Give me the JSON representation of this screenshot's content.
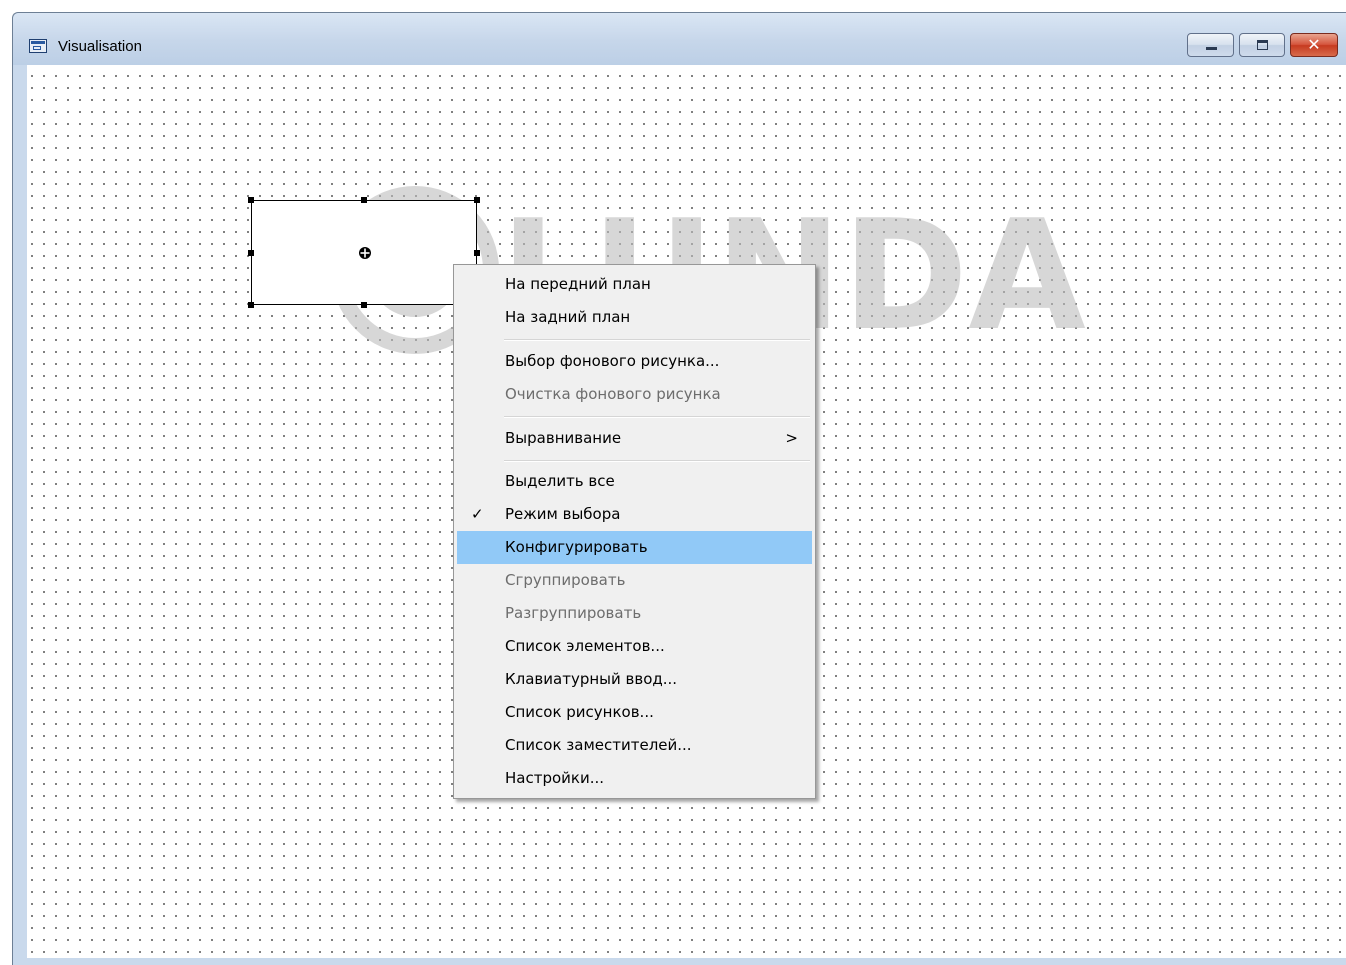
{
  "window": {
    "title": "Visualisation",
    "close_glyph": "✕"
  },
  "watermark": {
    "text": "LUNDA"
  },
  "context_menu": {
    "items": [
      {
        "label": "На передний план"
      },
      {
        "label": "На задний план"
      },
      {
        "label": "Выбор фонового рисунка..."
      },
      {
        "label": "Очистка фонового рисунка",
        "disabled": true
      },
      {
        "label": "Выравнивание",
        "submenu_arrow": ">"
      },
      {
        "label": "Выделить все"
      },
      {
        "label": "Режим выбора",
        "check": "✓"
      },
      {
        "label": "Конфигурировать",
        "highlighted": true
      },
      {
        "label": "Сгруппировать",
        "disabled": true
      },
      {
        "label": "Разгруппировать",
        "disabled": true
      },
      {
        "label": "Список элементов..."
      },
      {
        "label": "Клавиатурный ввод..."
      },
      {
        "label": "Список рисунков..."
      },
      {
        "label": "Список заместителей..."
      },
      {
        "label": "Настройки..."
      }
    ]
  },
  "colors": {
    "highlight": "#91c9f7",
    "menu_background": "#f0f0f0",
    "title_bar": "#c6d6ea",
    "disabled_text": "#6d6d6d"
  }
}
